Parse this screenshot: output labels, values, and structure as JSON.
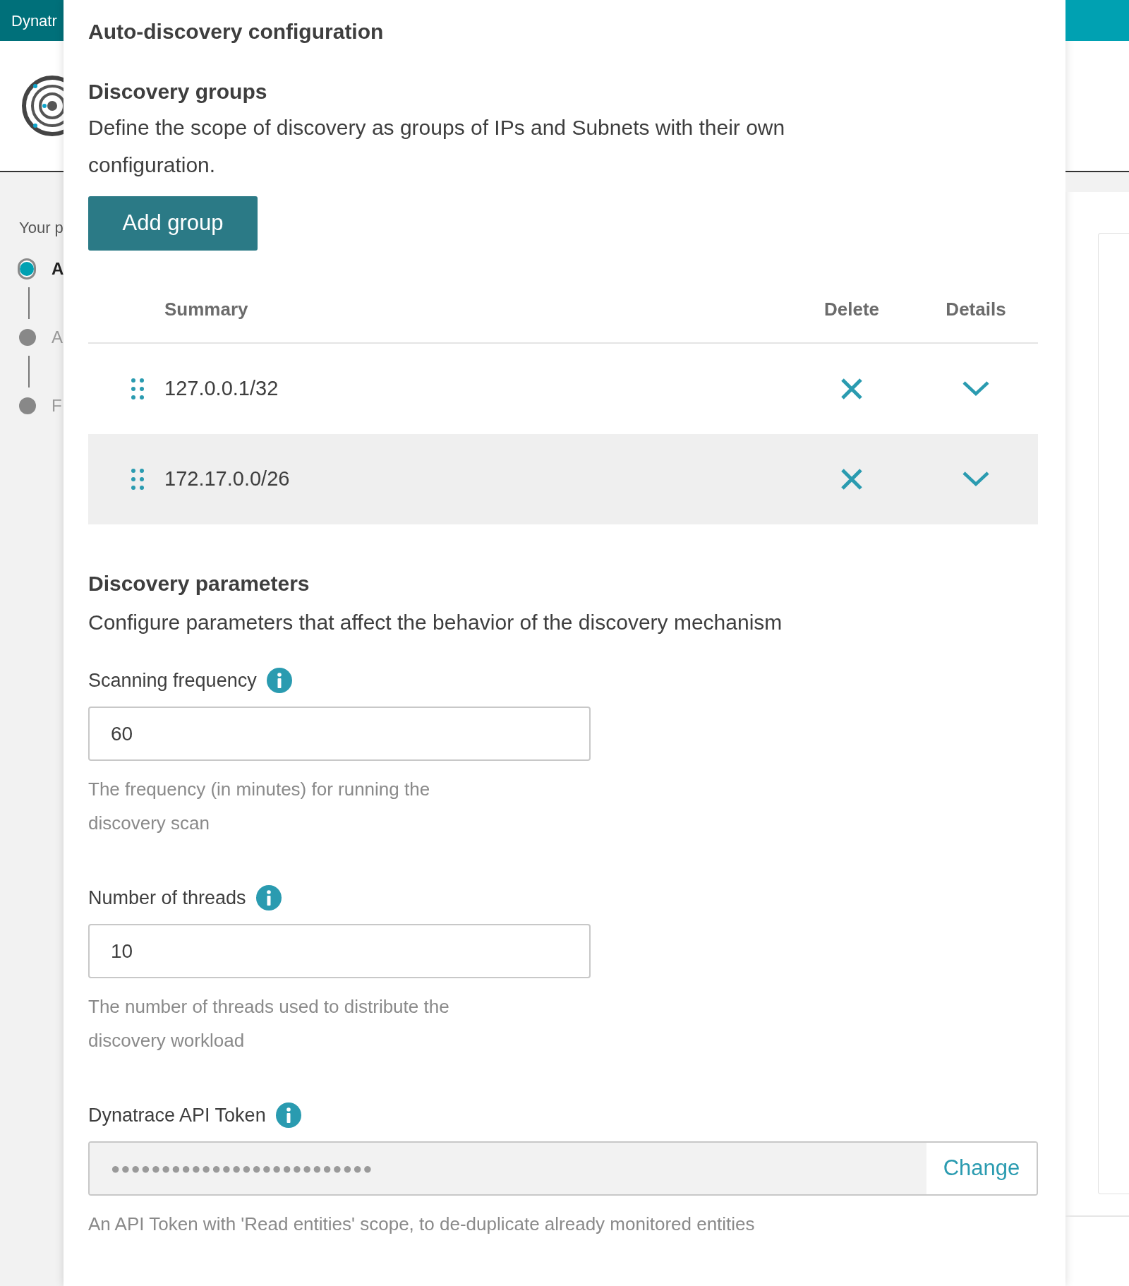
{
  "background": {
    "header_title": "Dynatr",
    "steps_heading": "Your p",
    "steps": [
      {
        "label": "A",
        "selected": true
      },
      {
        "label": "A",
        "selected": false
      },
      {
        "label": "F",
        "selected": false
      }
    ]
  },
  "panel": {
    "title": "Auto-discovery configuration",
    "groups": {
      "heading": "Discovery groups",
      "description": "Define the scope of discovery as groups of IPs and Subnets with their own configuration.",
      "add_button": "Add group",
      "columns": [
        "Summary",
        "Delete",
        "Details"
      ],
      "rows": [
        {
          "summary": "127.0.0.1/32",
          "hovered": false
        },
        {
          "summary": "172.17.0.0/26",
          "hovered": true
        }
      ]
    },
    "parameters": {
      "heading": "Discovery parameters",
      "description": "Configure parameters that affect the behavior of the discovery mechanism",
      "fields": [
        {
          "kind": "text",
          "label": "Scanning frequency",
          "value": "60",
          "help": "The frequency (in minutes) for running the discovery scan"
        },
        {
          "kind": "text",
          "label": "Number of threads",
          "value": "10",
          "help": "The number of threads used to distribute the discovery workload"
        },
        {
          "kind": "token",
          "label": "Dynatrace API Token",
          "value": "●●●●●●●●●●●●●●●●●●●●●●●●●●",
          "action": "Change",
          "help": "An API Token with 'Read entities' scope, to de-duplicate already monitored entities"
        }
      ]
    }
  }
}
